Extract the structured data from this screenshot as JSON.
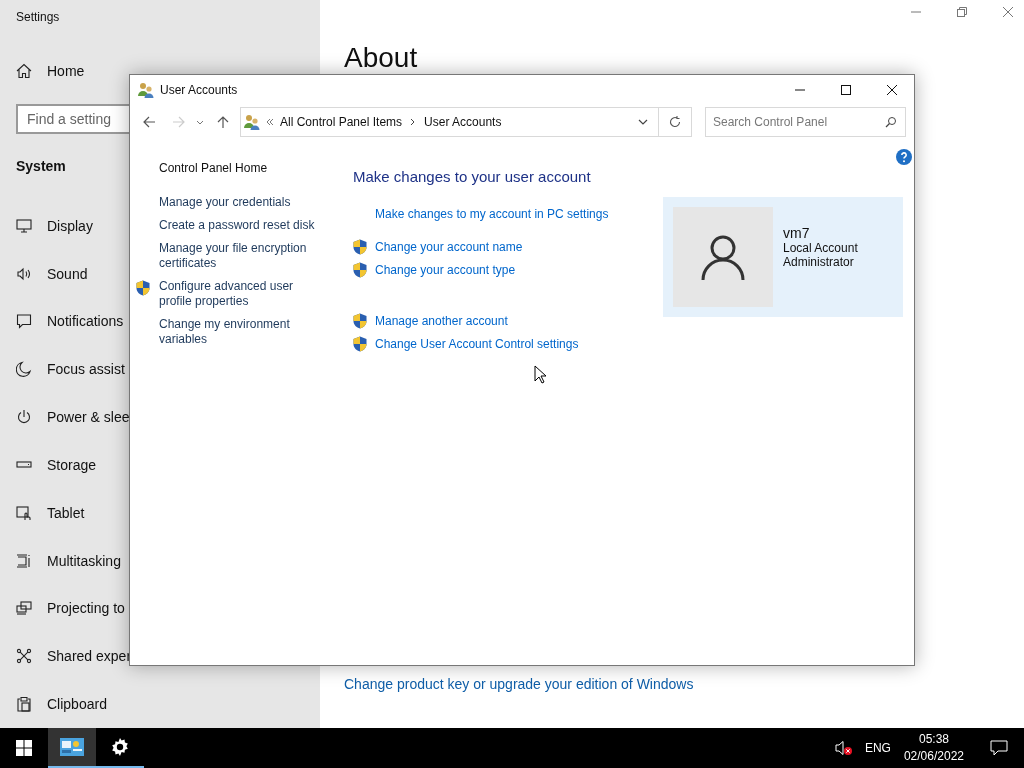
{
  "settings": {
    "title": "Settings",
    "home": "Home",
    "search": {
      "placeholder": "Find a setting"
    },
    "section": "System",
    "nav": [
      {
        "label": "Display",
        "kind": "display"
      },
      {
        "label": "Sound",
        "kind": "sound"
      },
      {
        "label": "Notifications",
        "kind": "notifications"
      },
      {
        "label": "Focus assist",
        "kind": "focus"
      },
      {
        "label": "Power & slee",
        "kind": "power"
      },
      {
        "label": "Storage",
        "kind": "storage"
      },
      {
        "label": "Tablet",
        "kind": "tablet"
      },
      {
        "label": "Multitasking",
        "kind": "multitasking"
      },
      {
        "label": "Projecting to",
        "kind": "projecting"
      },
      {
        "label": "Shared exper",
        "kind": "shared"
      },
      {
        "label": "Clipboard",
        "kind": "clipboard"
      }
    ],
    "heading": "About",
    "product_link": "Change product key or upgrade your edition of Windows"
  },
  "dialog": {
    "title": "User Accounts",
    "breadcrumb": [
      "All Control Panel Items",
      "User Accounts"
    ],
    "search": {
      "placeholder": "Search Control Panel"
    },
    "home_link": "Control Panel Home",
    "side_links": [
      {
        "label": "Manage your credentials",
        "shield": false
      },
      {
        "label": "Create a password reset disk",
        "shield": false
      },
      {
        "label": "Manage your file encryption certificates",
        "shield": false
      },
      {
        "label": "Configure advanced user profile properties",
        "shield": true
      },
      {
        "label": "Change my environment variables",
        "shield": false
      }
    ],
    "heading": "Make changes to your user account",
    "pc_settings_link": "Make changes to my account in PC settings",
    "task_groups": [
      [
        {
          "label": "Change your account name",
          "shield": true
        },
        {
          "label": "Change your account type",
          "shield": true
        }
      ],
      [
        {
          "label": "Manage another account",
          "shield": true
        },
        {
          "label": "Change User Account Control settings",
          "shield": true
        }
      ]
    ],
    "account": {
      "name": "vm7",
      "type": "Local Account",
      "role": "Administrator"
    }
  },
  "taskbar": {
    "apps": [
      {
        "kind": "control-panel",
        "selected": true
      },
      {
        "kind": "settings",
        "selected": false
      }
    ],
    "language": "ENG",
    "time": "05:38",
    "date": "02/06/2022"
  }
}
